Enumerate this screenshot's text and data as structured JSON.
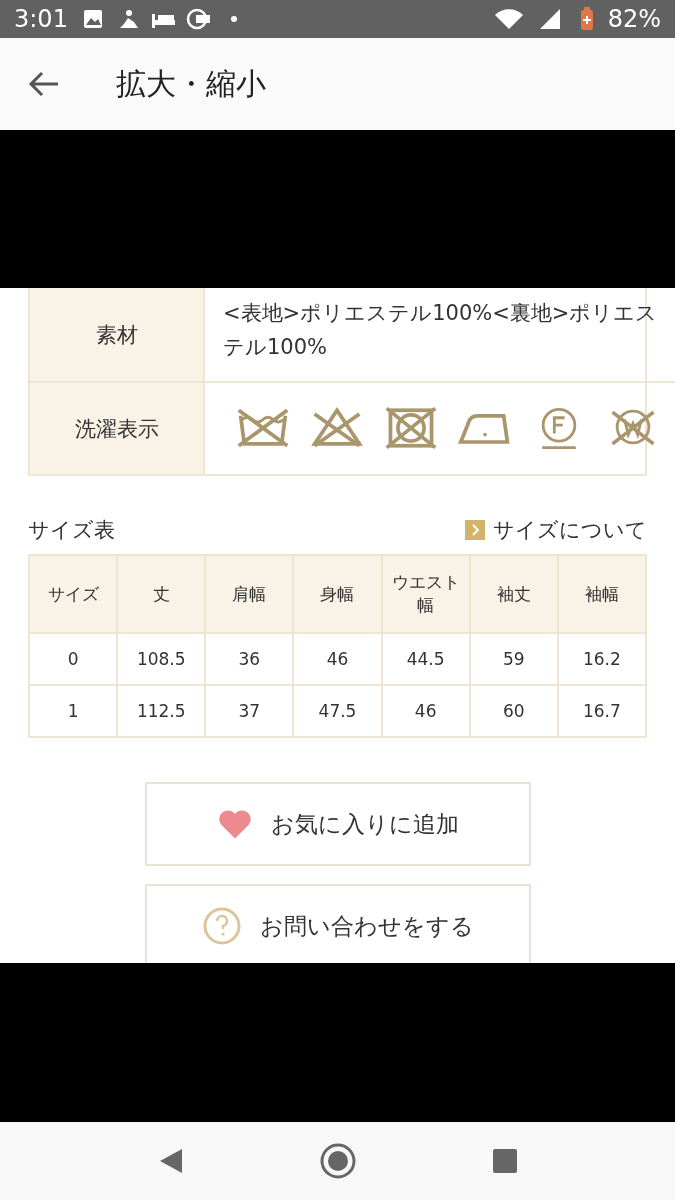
{
  "status_bar": {
    "time": "3:01",
    "battery": "82%"
  },
  "app_bar": {
    "title": "拡大・縮小"
  },
  "spec_table": {
    "rows": [
      {
        "kind": "text",
        "label": "素材",
        "value": "<表地>ポリエステル100%<裏地>ポリエステル100%"
      },
      {
        "kind": "care",
        "label": "洗濯表示"
      }
    ]
  },
  "size_chart": {
    "title": "サイズ表",
    "link": "サイズについて",
    "columns": [
      "サイズ",
      "丈",
      "肩幅",
      "身幅",
      "ウエスト幅",
      "袖丈",
      "袖幅"
    ],
    "rows": [
      [
        "0",
        "108.5",
        "36",
        "46",
        "44.5",
        "59",
        "16.2"
      ],
      [
        "1",
        "112.5",
        "37",
        "47.5",
        "46",
        "60",
        "16.7"
      ]
    ]
  },
  "buttons": [
    {
      "kind": "favorite",
      "label": "お気に入りに追加"
    },
    {
      "kind": "inquiry",
      "label": "お問い合わせをする"
    }
  ]
}
